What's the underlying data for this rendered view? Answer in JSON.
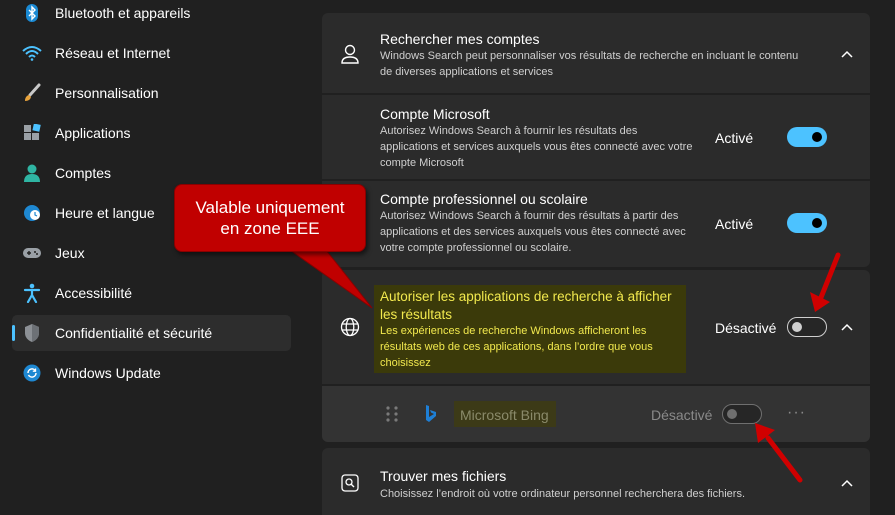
{
  "sidebar": {
    "items": [
      {
        "label": "Bluetooth et appareils",
        "icon": "bluetooth-icon"
      },
      {
        "label": "Réseau et Internet",
        "icon": "wifi-icon"
      },
      {
        "label": "Personnalisation",
        "icon": "brush-icon"
      },
      {
        "label": "Applications",
        "icon": "apps-icon"
      },
      {
        "label": "Comptes",
        "icon": "person-icon"
      },
      {
        "label": "Heure et langue",
        "icon": "clock-globe-icon"
      },
      {
        "label": "Jeux",
        "icon": "gamepad-icon"
      },
      {
        "label": "Accessibilité",
        "icon": "accessibility-icon"
      },
      {
        "label": "Confidentialité et sécurité",
        "icon": "shield-icon"
      },
      {
        "label": "Windows Update",
        "icon": "update-icon"
      }
    ],
    "active_index": 8
  },
  "main": {
    "search_accounts": {
      "title": "Rechercher mes comptes",
      "desc": "Windows Search peut personnaliser vos résultats de recherche en incluant le contenu de diverses applications et services"
    },
    "microsoft_account": {
      "title": "Compte Microsoft",
      "desc": "Autorisez Windows Search à fournir les résultats des applications et services auxquels vous êtes connecté avec votre compte Microsoft",
      "status": "Activé"
    },
    "work_account": {
      "title": "Compte professionnel ou scolaire",
      "desc": "Autorisez Windows Search à fournir des résultats à partir des applications et des services auxquels vous êtes connecté avec votre compte professionnel ou scolaire.",
      "status": "Activé"
    },
    "search_apps": {
      "title": "Autoriser les applications de recherche à afficher les résultats",
      "desc": "Les expériences de recherche Windows afficheront les résultats web de ces applications, dans l’ordre que vous choisissez",
      "status": "Désactivé"
    },
    "bing": {
      "label": "Microsoft Bing",
      "status": "Désactivé",
      "more": "···"
    },
    "find_files": {
      "title": "Trouver mes fichiers",
      "desc": "Choisissez l’endroit où votre ordinateur personnel recherchera des fichiers."
    }
  },
  "callout": {
    "line1": "Valable uniquement",
    "line2": "en zone EEE"
  },
  "colors": {
    "accent": "#4cc2ff",
    "callout": "#c00000",
    "highlight_text": "#f2e94e",
    "arrow": "#d00000"
  }
}
